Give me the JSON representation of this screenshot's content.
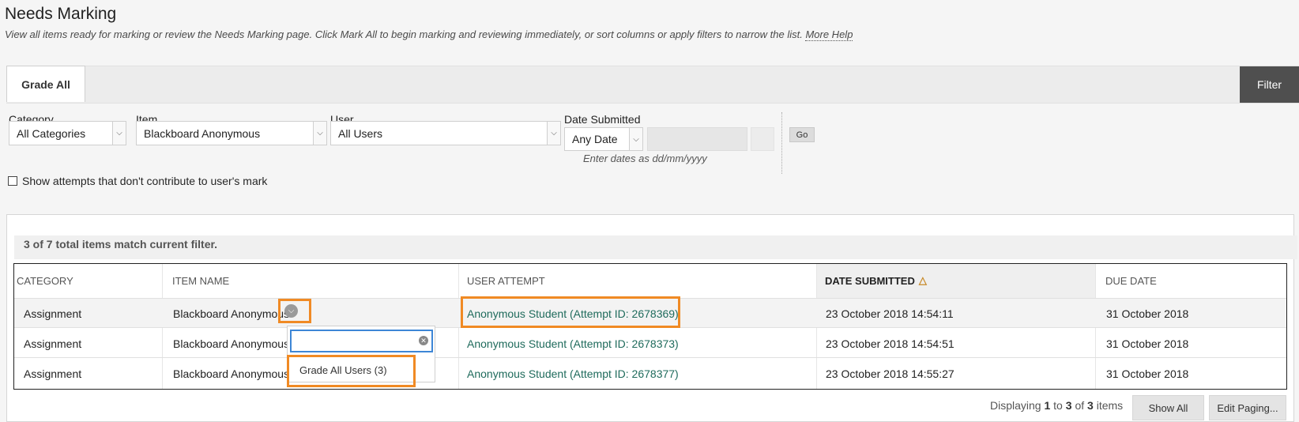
{
  "header": {
    "title": "Needs Marking",
    "description": "View all items ready for marking or review the Needs Marking page. Click Mark All to begin marking and reviewing immediately, or sort columns or apply filters to narrow the list.",
    "help_link": "More Help"
  },
  "tabs": {
    "grade_all": "Grade All",
    "filter": "Filter"
  },
  "filters": {
    "category": {
      "label": "Category",
      "value": "All Categories"
    },
    "item": {
      "label": "Item",
      "value": "Blackboard Anonymous"
    },
    "user": {
      "label": "User",
      "value": "All Users"
    },
    "date": {
      "label": "Date Submitted",
      "value": "Any Date",
      "hint": "Enter dates as dd/mm/yyyy"
    },
    "go": "Go",
    "show_attempts": "Show attempts that don't contribute to user's mark"
  },
  "results": {
    "match_text": "3 of 7 total items match current filter.",
    "columns": [
      "CATEGORY",
      "ITEM NAME",
      "USER ATTEMPT",
      "DATE SUBMITTED",
      "DUE DATE"
    ],
    "sort_indicator": "△",
    "rows": [
      {
        "category": "Assignment",
        "item": "Blackboard Anonymous",
        "attempt": "Anonymous Student (Attempt ID: 2678369)",
        "submitted": "23 October 2018 14:54:11",
        "due": "31 October 2018"
      },
      {
        "category": "Assignment",
        "item": "Blackboard Anonymous",
        "attempt": "Anonymous Student (Attempt ID: 2678373)",
        "submitted": "23 October 2018 14:54:51",
        "due": "31 October 2018"
      },
      {
        "category": "Assignment",
        "item": "Blackboard Anonymous",
        "attempt": "Anonymous Student (Attempt ID: 2678377)",
        "submitted": "23 October 2018 14:55:27",
        "due": "31 October 2018"
      }
    ]
  },
  "context_menu": {
    "item": "Grade All Users (3)"
  },
  "paging": {
    "prefix": "Displaying",
    "from": "1",
    "to_word": "to",
    "to": "3",
    "of_word": "of",
    "total": "3",
    "suffix": "items",
    "show_all": "Show All",
    "edit_paging": "Edit Paging..."
  },
  "colors": {
    "highlight": "#f08a24",
    "link": "#1f6b5c",
    "filter_tab": "#4f4f4f",
    "focus": "#3d86d6"
  },
  "icons": {
    "menu": "chevron-down-circle-icon",
    "clear": "clear-icon",
    "sort": "sort-up-icon",
    "select": "chevron-down-icon"
  }
}
